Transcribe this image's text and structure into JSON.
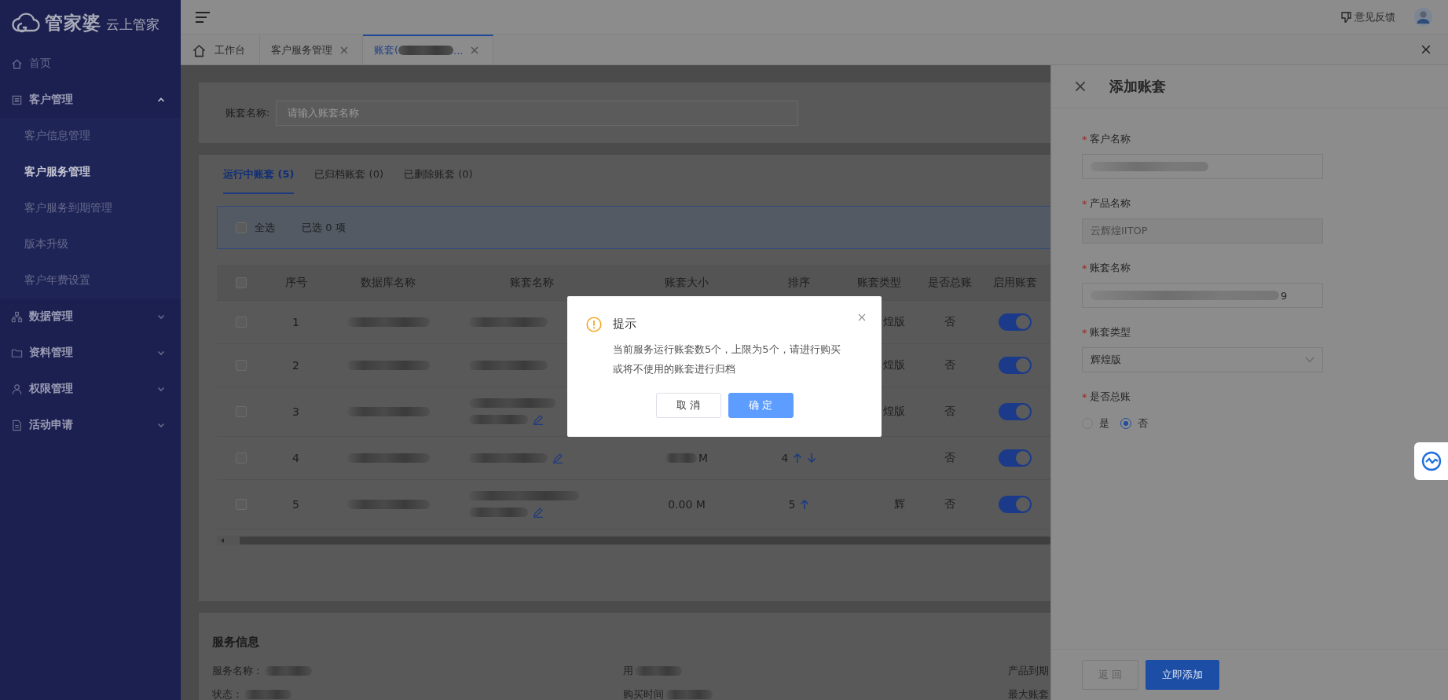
{
  "brand": {
    "name": "管家婆",
    "tagline": "云上管家"
  },
  "sidebar": {
    "items": [
      {
        "label": "首页",
        "kind": "link"
      },
      {
        "label": "客户管理",
        "kind": "group",
        "expanded": true,
        "children": [
          {
            "label": "客户信息管理",
            "selected": false
          },
          {
            "label": "客户服务管理",
            "selected": true
          },
          {
            "label": "客户服务到期管理",
            "selected": false
          },
          {
            "label": "版本升级",
            "selected": false
          },
          {
            "label": "客户年费设置",
            "selected": false
          }
        ]
      },
      {
        "label": "数据管理",
        "kind": "group",
        "expanded": false
      },
      {
        "label": "资料管理",
        "kind": "group",
        "expanded": false
      },
      {
        "label": "权限管理",
        "kind": "group",
        "expanded": false
      },
      {
        "label": "活动申请",
        "kind": "group",
        "expanded": false
      }
    ]
  },
  "header": {
    "feedback": "意见反馈"
  },
  "tabs": [
    {
      "label": "工作台",
      "kind": "home",
      "selected": false
    },
    {
      "label": "客户服务管理",
      "kind": "page",
      "selected": false
    },
    {
      "label": "账套(",
      "suffix": "...",
      "kind": "page",
      "selected": true
    }
  ],
  "search": {
    "label": "账套名称:",
    "placeholder": "请输入账套名称"
  },
  "ledger_tabs": [
    {
      "label": "运行中账套 (5)",
      "selected": true
    },
    {
      "label": "已归档账套 (0)",
      "selected": false
    },
    {
      "label": "已删除账套 (0)",
      "selected": false
    }
  ],
  "selection": {
    "select_all": "全选",
    "checked": false,
    "count": "已选 0 项"
  },
  "table": {
    "all_checked": false,
    "columns": [
      "序号",
      "数据库名称",
      "账套名称",
      "账套大小",
      "排序",
      "账套类型",
      "是否总账",
      "启用账套"
    ],
    "rows": [
      {
        "checked": false,
        "index": "1",
        "wrapped": false,
        "edit_icon": false,
        "type": "煌版",
        "general": "否",
        "enabled": true
      },
      {
        "checked": false,
        "index": "2",
        "wrapped": false,
        "edit_icon": false,
        "type": "煌版",
        "general": "否",
        "enabled": true
      },
      {
        "checked": false,
        "index": "3",
        "wrapped": true,
        "edit_icon": true,
        "type": "煌版",
        "general": "否",
        "enabled": true
      },
      {
        "checked": false,
        "index": "4",
        "wrapped": false,
        "edit_icon": true,
        "size": "M",
        "size_blurred": true,
        "sort": "4",
        "can_up": true,
        "can_down": true,
        "general": "否",
        "enabled": true
      },
      {
        "checked": false,
        "index": "5",
        "wrapped": true,
        "edit_icon": true,
        "size": "0.00 M",
        "size_blurred": false,
        "sort": "5",
        "can_up": true,
        "can_down": false,
        "type": "辉",
        "general": "否",
        "enabled": true
      }
    ]
  },
  "service_info": {
    "title": "服务信息",
    "fields": [
      {
        "label": "服务名称：",
        "blurred": true
      },
      {
        "label": "用",
        "blurred": true
      },
      {
        "label": "产品到期"
      },
      {
        "label": "状态：",
        "blurred": true
      },
      {
        "label": "购买时间",
        "blurred": true
      },
      {
        "label": "最大账套"
      }
    ]
  },
  "drawer": {
    "title": "添加账套",
    "fields": [
      {
        "mark": "*",
        "label": "客户名称",
        "kind": "input",
        "blurred": true,
        "disabled": false
      },
      {
        "mark": "*",
        "label": "产品名称",
        "kind": "input",
        "value": "云辉煌IITOP",
        "blurred": false,
        "disabled": true
      },
      {
        "mark": "*",
        "label": "账套名称",
        "kind": "input",
        "value": "9",
        "blurred": true,
        "disabled": false
      },
      {
        "mark": "*",
        "label": "账套类型",
        "kind": "select",
        "value": "辉煌版"
      },
      {
        "mark": "*",
        "label": "是否总账",
        "kind": "radio",
        "options": [
          {
            "label": "是",
            "selected": false
          },
          {
            "label": "否",
            "selected": true
          }
        ]
      }
    ],
    "buttons": [
      {
        "label": "返 回",
        "kind": "secondary"
      },
      {
        "label": "立即添加",
        "kind": "primary"
      }
    ]
  },
  "dialog": {
    "title": "提示",
    "message": "当前服务运行账套数5个，上限为5个，请进行购买或将不使用的账套进行归档",
    "buttons": [
      {
        "label": "取 消",
        "kind": "default"
      },
      {
        "label": "确 定",
        "kind": "primary"
      }
    ]
  }
}
